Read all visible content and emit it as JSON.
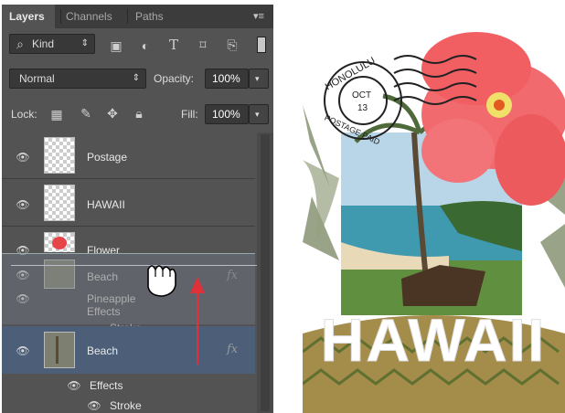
{
  "tabs": [
    "Layers",
    "Channels",
    "Paths"
  ],
  "filter": {
    "label": "Kind"
  },
  "blend": {
    "mode": "Normal",
    "opacity_label": "Opacity:",
    "opacity_value": "100%"
  },
  "lock": {
    "label": "Lock:",
    "fill_label": "Fill:",
    "fill_value": "100%"
  },
  "layers": [
    {
      "name": "Postage"
    },
    {
      "name": "HAWAII"
    },
    {
      "name": "Flower"
    },
    {
      "name": "Beach",
      "fx": "fx"
    }
  ],
  "ghost": {
    "beach": "Beach",
    "pineapple": "Pineapple",
    "effects": "Effects",
    "stroke": "Stroke",
    "fx": "fx"
  },
  "beach_effects": {
    "effects": "Effects",
    "stroke": "Stroke"
  },
  "postmark": {
    "city": "HONOLULU",
    "date": "OCT",
    "day": "13",
    "paid": "POSTAGE PAID"
  },
  "poster": {
    "title": "HAWAII"
  },
  "colors": {
    "panel": "#535353",
    "accent_arrow": "#e0303a",
    "flower": "#f05a5f"
  }
}
